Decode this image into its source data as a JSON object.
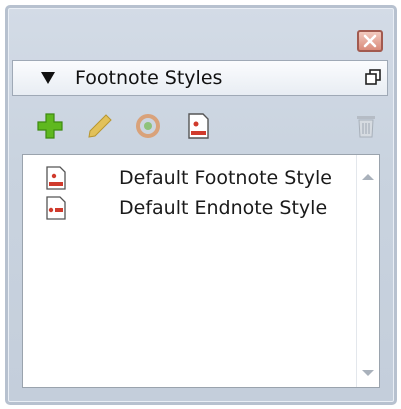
{
  "panel": {
    "title": "Footnote Styles"
  },
  "toolbar": {
    "buttons": [
      {
        "icon": "add-icon"
      },
      {
        "icon": "edit-pencil-icon"
      },
      {
        "icon": "duplicate-icon"
      },
      {
        "icon": "style-document-icon"
      },
      {
        "icon": "trash-icon"
      }
    ]
  },
  "list": {
    "items": [
      {
        "label": "Default Footnote Style",
        "icon": "footnote-style-icon"
      },
      {
        "label": "Default Endnote Style",
        "icon": "endnote-style-icon"
      }
    ]
  },
  "colors": {
    "accent_green": "#5fb81f",
    "accent_red": "#d03a2c",
    "frame": "#b7c1cf"
  }
}
